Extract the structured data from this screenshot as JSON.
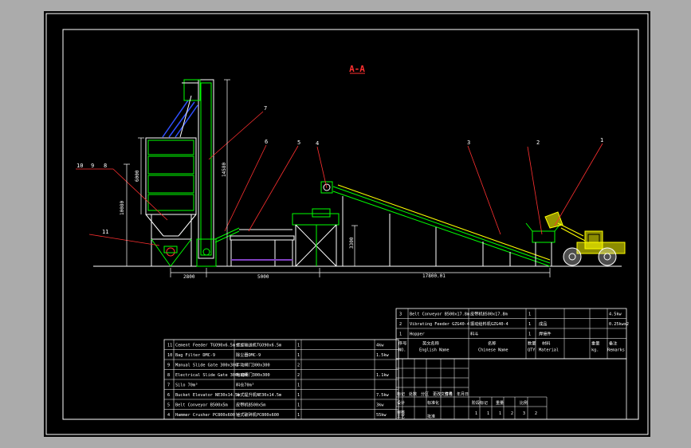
{
  "drawing": {
    "view_label": "A-A",
    "colors": {
      "background": "#ababab",
      "sheet": "#000000",
      "border": "#ffffff",
      "structure": "#ffffff",
      "equipment": "#00ff00",
      "accent": "#ffff00",
      "leader": "#ff3030",
      "dims": "#ffffff",
      "ducts": "#3050ff",
      "conveyor_base": "#8040c0",
      "table_text": "#ffffff"
    }
  },
  "callouts": [
    "10",
    "9",
    "8",
    "11",
    "7",
    "6",
    "5",
    "4",
    "3",
    "2",
    "1"
  ],
  "dimensions": {
    "dim_2800": "2800",
    "dim_5000": "5000",
    "dim_17800": "17800.01",
    "dim_height_left": "10080",
    "dim_silo": "6000",
    "dim_elevator": "14580",
    "dim_hopper": "3300"
  },
  "bom_lower": {
    "rows": [
      {
        "no": "11",
        "english": "Cement Feeder TGO90x6.5m",
        "chinese": "螺旋输送机TGO90x6.5m",
        "qty": "1",
        "power": "4kw"
      },
      {
        "no": "10",
        "english": "Bag Filter DMC-9",
        "chinese": "除尘器DMC-9",
        "qty": "1",
        "power": "1.5kw"
      },
      {
        "no": "9",
        "english": "Manual Slide Gate 300x300",
        "chinese": "手动闸门300x300",
        "qty": "2",
        "power": ""
      },
      {
        "no": "8",
        "english": "Electrical Slide Gate 300x300",
        "chinese": "电动闸门300x300",
        "qty": "2",
        "power": "1.1kw"
      },
      {
        "no": "7",
        "english": "Silo 70m³",
        "chinese": "料仓70m³",
        "qty": "1",
        "power": ""
      },
      {
        "no": "6",
        "english": "Bucket Elevator NE30x14.5m",
        "chinese": "斗式提升机NE30x14.5m",
        "qty": "1",
        "power": "7.5kw"
      },
      {
        "no": "5",
        "english": "Belt Conveyor B500x5m",
        "chinese": "皮带机B500x5m",
        "qty": "1",
        "power": "3kw"
      },
      {
        "no": "4",
        "english": "Hammer Crusher PC800x600",
        "chinese": "锤式破碎机PC800x600",
        "qty": "1",
        "power": "55kw"
      }
    ]
  },
  "bom_upper": {
    "rows": [
      {
        "no": "3",
        "english": "Belt Conveyor B500x17.8m",
        "chinese": "皮带机B500x17.8m",
        "qty": "1",
        "material": "",
        "weight": "",
        "remark": "4.5kw"
      },
      {
        "no": "2",
        "english": "Vibrating Feeder GZG40-4",
        "chinese": "振动给料机GZG40-4",
        "qty": "1",
        "material": "成品",
        "weight": "",
        "remark": "0.25kwx2"
      },
      {
        "no": "1",
        "english": "Hopper",
        "chinese": "料斗",
        "qty": "1",
        "material": "焊接件",
        "weight": "",
        "remark": ""
      }
    ],
    "header": {
      "no": "序号",
      "no_en": "NO.",
      "english": "英文名称",
      "english_en": "English Name",
      "chinese": "名称",
      "chinese_en": "Chinese Name",
      "qty": "数量",
      "qty_en": "QTY",
      "material": "材料",
      "material_en": "Material",
      "weight": "重量",
      "weight_en": "kg.",
      "remark": "备注",
      "remark_en": "Remarks"
    }
  },
  "title_block": {
    "r1": [
      "标记",
      "处数",
      "分区",
      "更改文件号",
      "签名",
      "年月日"
    ],
    "r2": [
      "设计",
      "标准化"
    ],
    "r3": [
      "审核"
    ],
    "r4": [
      "工艺",
      "批准"
    ],
    "stage_labels": [
      "阶段标记",
      "重量",
      "比例"
    ],
    "scale_nums": [
      "1",
      "1",
      "1",
      "2",
      "3",
      "2"
    ]
  }
}
